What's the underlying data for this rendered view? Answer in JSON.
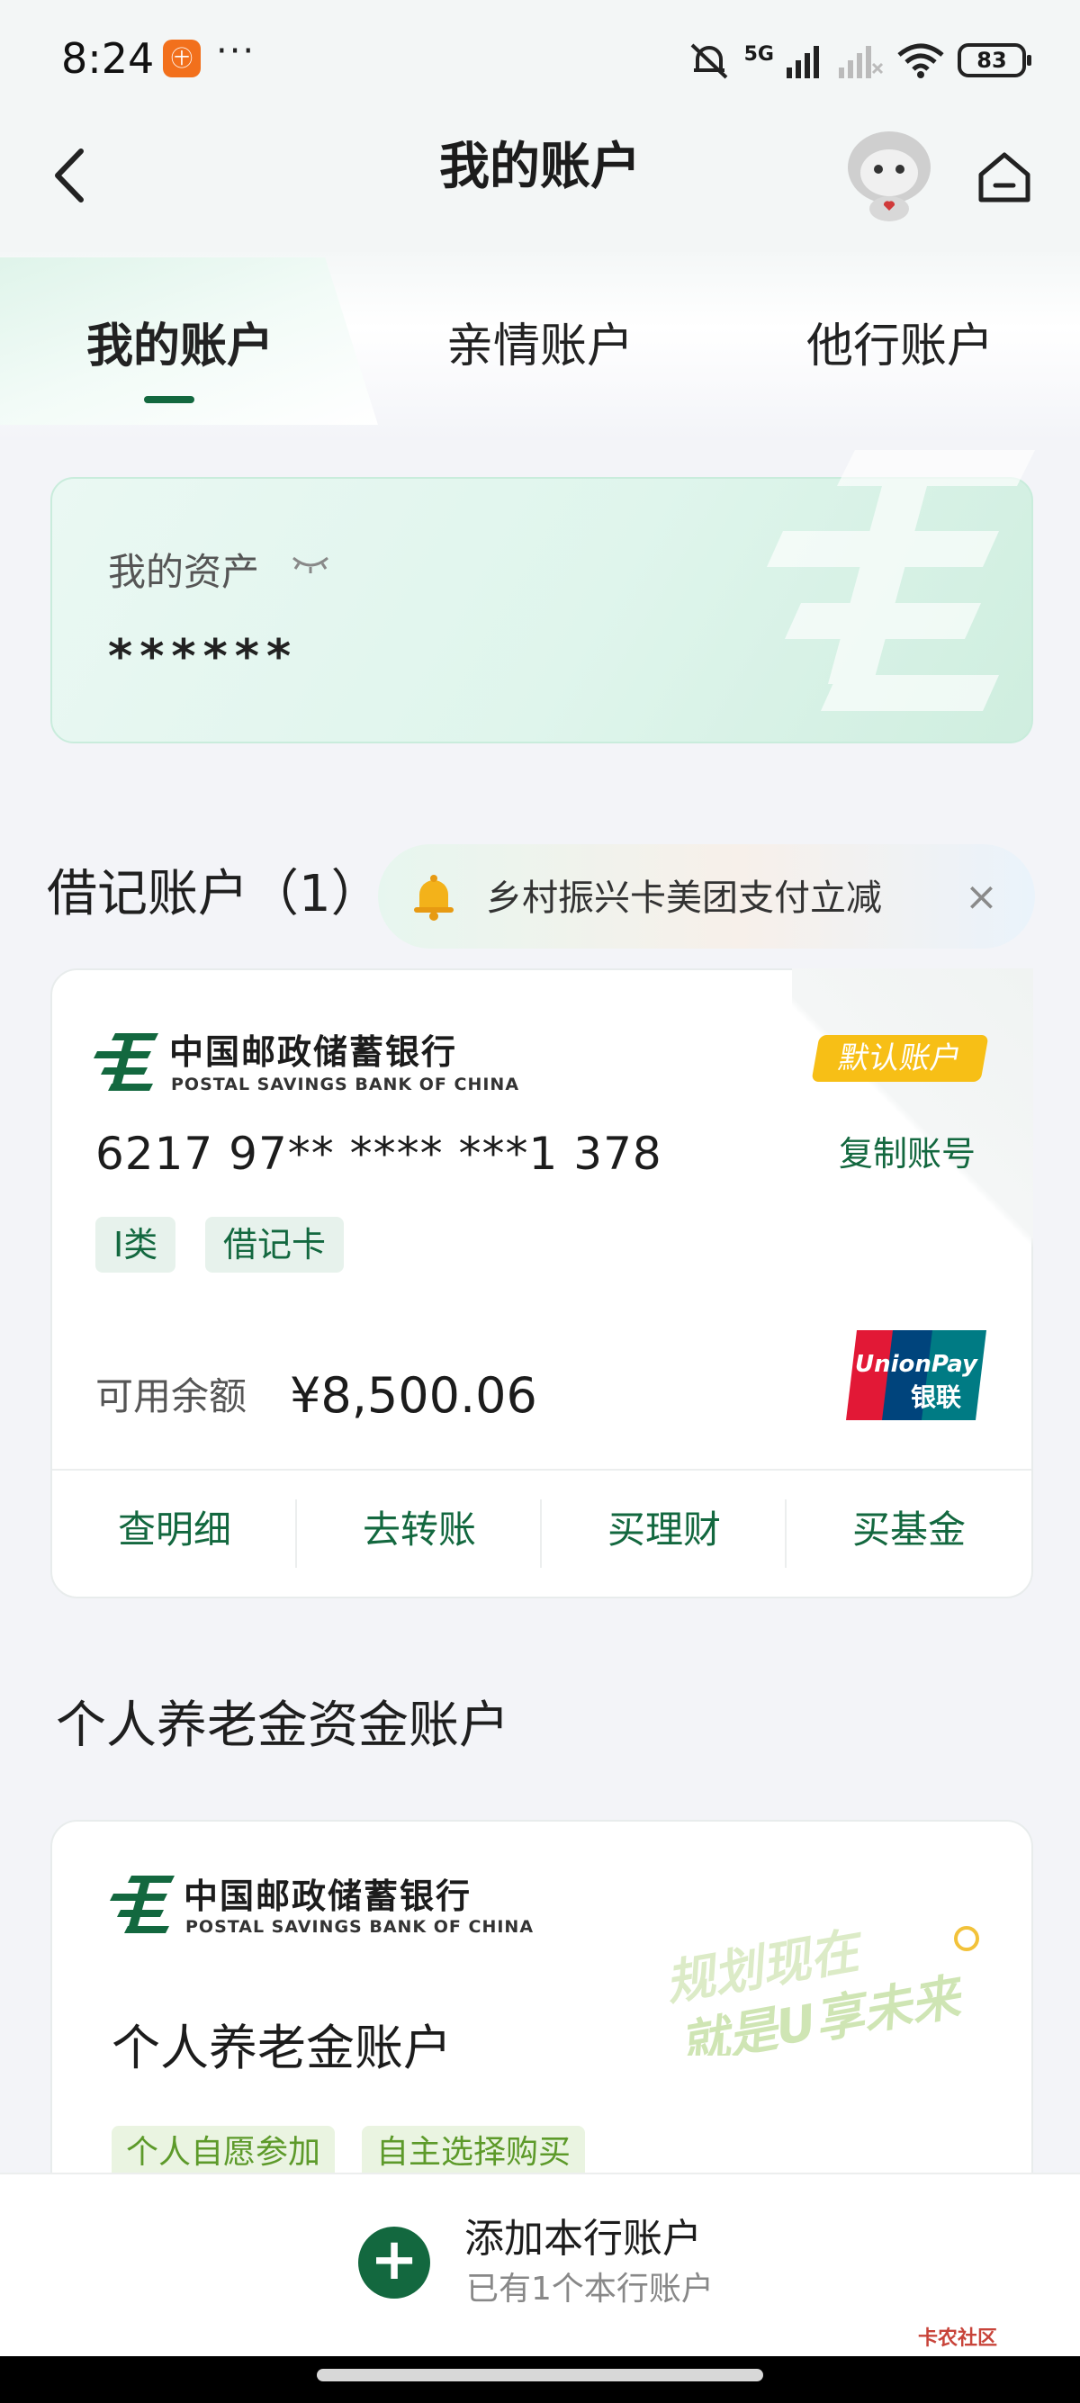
{
  "status_bar": {
    "time": "8:24",
    "app_badge_glyph": "㊉",
    "more": "···",
    "network": "5G",
    "battery": "83"
  },
  "header": {
    "title": "我的账户"
  },
  "tabs": [
    {
      "label": "我的账户",
      "active": true
    },
    {
      "label": "亲情账户",
      "active": false
    },
    {
      "label": "他行账户",
      "active": false
    }
  ],
  "assets": {
    "label": "我的资产",
    "value": "******"
  },
  "debit": {
    "section_title": "借记账户（1）",
    "promo_text": "乡村振兴卡美团支付立减",
    "promo_close": "×",
    "card": {
      "bank_name_cn": "中国邮政储蓄银行",
      "bank_name_en": "POSTAL SAVINGS BANK OF CHINA",
      "default_badge": "默认账户",
      "number": "6217 97** **** ***1 378",
      "copy_label": "复制账号",
      "tags": [
        "I类",
        "借记卡"
      ],
      "balance_label": "可用余额",
      "balance_value": "¥8,500.06",
      "unionpay_en": "UnionPay",
      "unionpay_cn": "银联",
      "actions": [
        "查明细",
        "去转账",
        "买理财",
        "买基金"
      ]
    }
  },
  "pension": {
    "section_title": "个人养老金资金账户",
    "bank_name_cn": "中国邮政储蓄银行",
    "bank_name_en": "POSTAL SAVINGS BANK OF CHINA",
    "slogan_line1": "规划现在",
    "slogan_line2": "就是U享未来",
    "account_name": "个人养老金账户",
    "tags": [
      "个人自愿参加",
      "自主选择购买"
    ]
  },
  "bottom": {
    "add_label": "添加本行账户",
    "add_sub": "已有1个本行账户",
    "watermark": "卡农社区"
  },
  "colors": {
    "brand_green": "#13683f",
    "badge_yellow": "#f7bf16",
    "light_green": "#5d9a2a"
  }
}
